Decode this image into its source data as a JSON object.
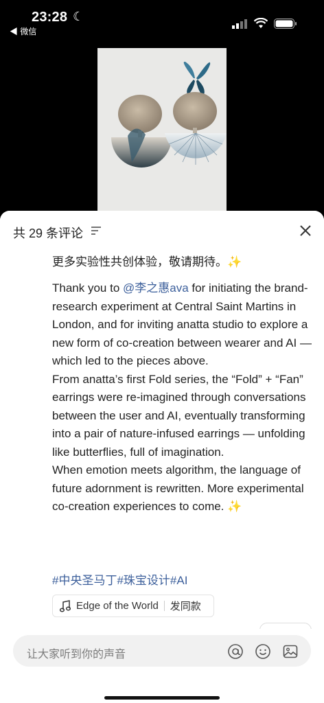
{
  "status_bar": {
    "time": "23:28",
    "back_app": "◀ 微信"
  },
  "comments_panel": {
    "title": "共 29 条评论"
  },
  "post": {
    "text_cn_end": "更多实验性共创体验，敬请期待。✨",
    "thanks_prefix": "Thank you to ",
    "mention": "@李之惠ava",
    "thanks_suffix": " for initiating the brand-research experiment at Central Saint Martins in London, and for inviting anatta studio to explore a new form of co-creation between wearer and AI — which led to the pieces above.",
    "para2": "From anatta’s first Fold series, the “Fold” + “Fan” earrings were re-imagined through conversations between the user and AI, eventually transforming into a pair of nature-infused earrings — unfolding like butterflies, full of imagination.",
    "para3": "When emotion meets algorithm, the language of future adornment is rewritten. More experimental co-creation experiences to come. ✨",
    "hashtags": "#中央圣马丁#珠宝设计#AI"
  },
  "music": {
    "song": "Edge of the World",
    "action": "发同款"
  },
  "input": {
    "placeholder": "让大家听到你的声音"
  }
}
